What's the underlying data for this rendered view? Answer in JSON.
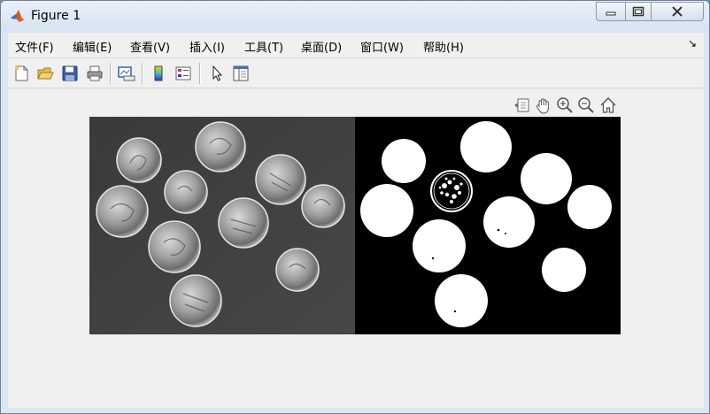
{
  "window": {
    "title": "Figure 1"
  },
  "menu": {
    "items": [
      "文件(F)",
      "编辑(E)",
      "查看(V)",
      "插入(I)",
      "工具(T)",
      "桌面(D)",
      "窗口(W)",
      "帮助(H)"
    ]
  },
  "toolbar": {
    "icons": [
      "new-figure-icon",
      "open-file-icon",
      "save-icon",
      "print-icon",
      "link-plot-icon",
      "colorbar-icon",
      "legend-icon",
      "pointer-icon",
      "property-editor-icon"
    ]
  },
  "axes_toolbar": {
    "icons": [
      "data-tips-icon",
      "pan-icon",
      "zoom-in-icon",
      "zoom-out-icon",
      "home-icon"
    ]
  },
  "figure": {
    "images": [
      "grayscale-coins-image",
      "binary-coins-mask-image"
    ]
  }
}
